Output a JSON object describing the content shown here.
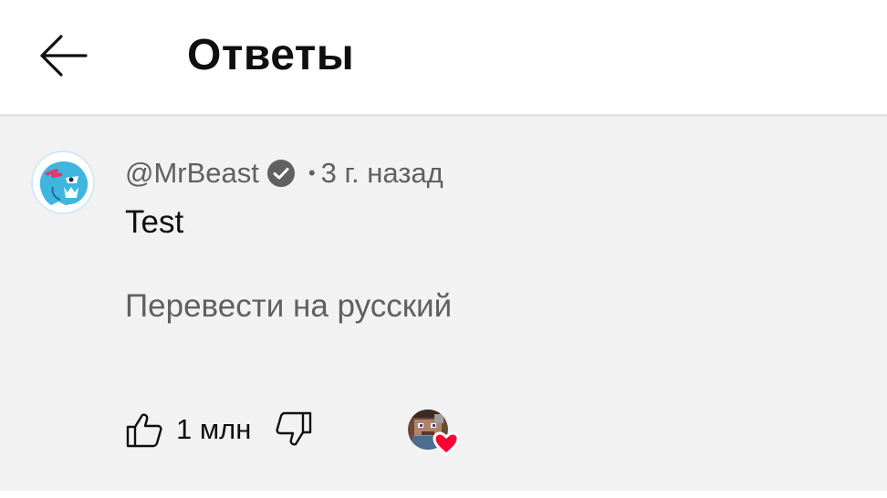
{
  "header": {
    "title": "Ответы",
    "back_icon": "arrow-left-icon"
  },
  "comment": {
    "author": "@MrBeast",
    "verified_icon": "verified-check-icon",
    "separator": "•",
    "time": "3 г. назад",
    "text": "Test",
    "translate_label": "Перевести на русский",
    "like_count": "1 млн",
    "like_icon": "thumbs-up-icon",
    "dislike_icon": "thumbs-down-icon",
    "creator_heart_icon": "heart-icon"
  },
  "colors": {
    "background": "#f2f2f2",
    "header_bg": "#ffffff",
    "primary_text": "#0f0f0f",
    "secondary_text": "#606060",
    "heart": "#ff0033",
    "avatar_blue": "#3fb6e0"
  }
}
